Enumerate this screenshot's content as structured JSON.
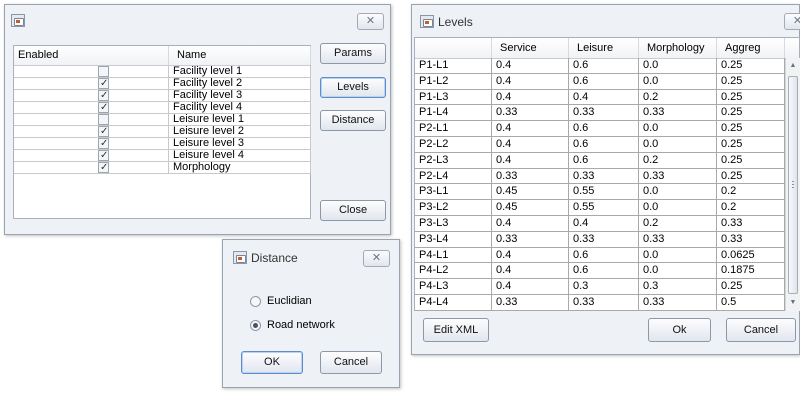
{
  "enabled_window": {
    "headers": {
      "enabled": "Enabled",
      "name": "Name"
    },
    "rows": [
      {
        "enabled": false,
        "name": "Facility level 1"
      },
      {
        "enabled": true,
        "name": "Facility level 2"
      },
      {
        "enabled": true,
        "name": "Facility level 3"
      },
      {
        "enabled": true,
        "name": "Facility level 4"
      },
      {
        "enabled": false,
        "name": "Leisure level 1"
      },
      {
        "enabled": true,
        "name": "Leisure level 2"
      },
      {
        "enabled": true,
        "name": "Leisure level 3"
      },
      {
        "enabled": true,
        "name": "Leisure level 4"
      },
      {
        "enabled": true,
        "name": "Morphology"
      }
    ],
    "buttons": {
      "params": "Params",
      "levels": "Levels",
      "distance": "Distance",
      "close": "Close"
    },
    "close_glyph": "✕"
  },
  "distance_dialog": {
    "title": "Distance",
    "options": [
      {
        "label": "Euclidian",
        "selected": false
      },
      {
        "label": "Road network",
        "selected": true
      }
    ],
    "ok": "OK",
    "cancel": "Cancel",
    "close_glyph": "✕"
  },
  "levels_window": {
    "title": "Levels",
    "columns": [
      "",
      "Service",
      "Leisure",
      "Morphology",
      "Aggreg"
    ],
    "rows": [
      [
        "P1-L1",
        "0.4",
        "0.6",
        "0.0",
        "0.25"
      ],
      [
        "P1-L2",
        "0.4",
        "0.6",
        "0.0",
        "0.25"
      ],
      [
        "P1-L3",
        "0.4",
        "0.4",
        "0.2",
        "0.25"
      ],
      [
        "P1-L4",
        "0.33",
        "0.33",
        "0.33",
        "0.25"
      ],
      [
        "P2-L1",
        "0.4",
        "0.6",
        "0.0",
        "0.25"
      ],
      [
        "P2-L2",
        "0.4",
        "0.6",
        "0.0",
        "0.25"
      ],
      [
        "P2-L3",
        "0.4",
        "0.6",
        "0.2",
        "0.25"
      ],
      [
        "P2-L4",
        "0.33",
        "0.33",
        "0.33",
        "0.25"
      ],
      [
        "P3-L1",
        "0.45",
        "0.55",
        "0.0",
        "0.2"
      ],
      [
        "P3-L2",
        "0.45",
        "0.55",
        "0.0",
        "0.2"
      ],
      [
        "P3-L3",
        "0.4",
        "0.4",
        "0.2",
        "0.33"
      ],
      [
        "P3-L4",
        "0.33",
        "0.33",
        "0.33",
        "0.33"
      ],
      [
        "P4-L1",
        "0.4",
        "0.6",
        "0.0",
        "0.0625"
      ],
      [
        "P4-L2",
        "0.4",
        "0.6",
        "0.0",
        "0.1875"
      ],
      [
        "P4-L3",
        "0.4",
        "0.3",
        "0.3",
        "0.25"
      ],
      [
        "P4-L4",
        "0.33",
        "0.33",
        "0.33",
        "0.5"
      ]
    ],
    "buttons": {
      "edit_xml": "Edit XML",
      "ok": "Ok",
      "cancel": "Cancel"
    },
    "close_glyph": "✕",
    "scroll_up": "▲",
    "scroll_down": "▼"
  }
}
